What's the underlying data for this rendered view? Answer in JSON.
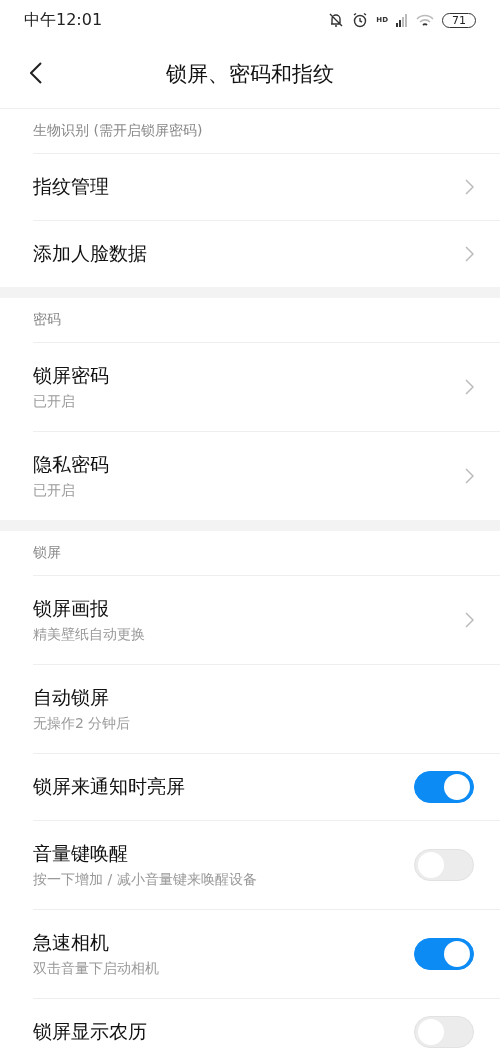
{
  "status_bar": {
    "time": "中午12:01",
    "network_label": "HD",
    "battery": "71"
  },
  "header": {
    "title": "锁屏、密码和指纹"
  },
  "sections": [
    {
      "title": "生物识别 (需开启锁屏密码)",
      "items": [
        {
          "kind": "link",
          "label": "指纹管理"
        },
        {
          "kind": "link",
          "label": "添加人脸数据"
        }
      ]
    },
    {
      "title": "密码",
      "items": [
        {
          "kind": "link",
          "label": "锁屏密码",
          "subtitle": "已开启"
        },
        {
          "kind": "link",
          "label": "隐私密码",
          "subtitle": "已开启"
        }
      ]
    },
    {
      "title": "锁屏",
      "items": [
        {
          "kind": "link",
          "label": "锁屏画报",
          "subtitle": "精美壁纸自动更换"
        },
        {
          "kind": "plain",
          "label": "自动锁屏",
          "subtitle": "无操作2 分钟后"
        },
        {
          "kind": "toggle",
          "label": "锁屏来通知时亮屏",
          "on": true
        },
        {
          "kind": "toggle",
          "label": "音量键唤醒",
          "subtitle": "按一下增加 / 减小音量键来唤醒设备",
          "on": false
        },
        {
          "kind": "toggle",
          "label": "急速相机",
          "subtitle": "双击音量下启动相机",
          "on": true
        },
        {
          "kind": "toggle",
          "label": "锁屏显示农历",
          "on": false
        }
      ]
    }
  ]
}
